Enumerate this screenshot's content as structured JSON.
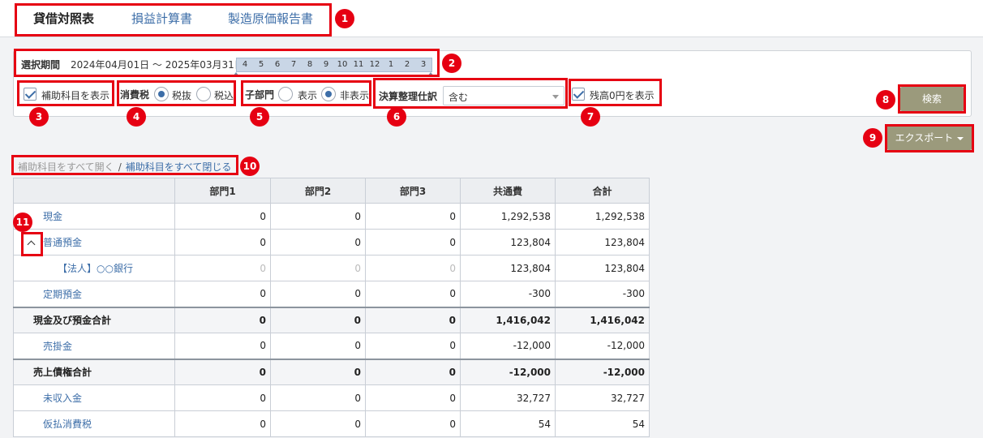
{
  "tabs": [
    {
      "label": "貸借対照表"
    },
    {
      "label": "損益計算書"
    },
    {
      "label": "製造原価報告書"
    }
  ],
  "period": {
    "label": "選択期間",
    "range": "2024年04月01日 ～ 2025年03月31日",
    "months": [
      "4",
      "5",
      "6",
      "7",
      "8",
      "9",
      "10",
      "11",
      "12",
      "1",
      "2",
      "3"
    ]
  },
  "filters": {
    "show_sub_accounts": "補助科目を表示",
    "tax_label": "消費税",
    "tax_excluded": "税抜",
    "tax_included": "税込",
    "subdept_label": "子部門",
    "subdept_show": "表示",
    "subdept_hide": "非表示",
    "closing_label": "決算整理仕訳",
    "closing_value": "含む",
    "show_zero": "残高0円を表示"
  },
  "buttons": {
    "search": "検索",
    "export": "エクスポート"
  },
  "links": {
    "expand_all": "補助科目をすべて開く",
    "separator": "/",
    "collapse_all": "補助科目をすべて閉じる"
  },
  "annotations": [
    "1",
    "2",
    "3",
    "4",
    "5",
    "6",
    "7",
    "8",
    "9",
    "10",
    "11"
  ],
  "table": {
    "headers": [
      "",
      "部門1",
      "部門2",
      "部門3",
      "共通費",
      "合計"
    ],
    "rows": [
      {
        "name": "現金",
        "cells": [
          "0",
          "0",
          "0",
          "1,292,538",
          "1,292,538"
        ]
      },
      {
        "name": "普通預金",
        "cells": [
          "0",
          "0",
          "0",
          "123,804",
          "123,804"
        ]
      },
      {
        "name": "【法人】○○銀行",
        "cells": [
          "0",
          "0",
          "0",
          "123,804",
          "123,804"
        ]
      },
      {
        "name": "定期預金",
        "cells": [
          "0",
          "0",
          "0",
          "-300",
          "-300"
        ]
      },
      {
        "name": "現金及び預金合計",
        "cells": [
          "0",
          "0",
          "0",
          "1,416,042",
          "1,416,042"
        ]
      },
      {
        "name": "売掛金",
        "cells": [
          "0",
          "0",
          "0",
          "-12,000",
          "-12,000"
        ]
      },
      {
        "name": "売上債権合計",
        "cells": [
          "0",
          "0",
          "0",
          "-12,000",
          "-12,000"
        ]
      },
      {
        "name": "未収入金",
        "cells": [
          "0",
          "0",
          "0",
          "32,727",
          "32,727"
        ]
      },
      {
        "name": "仮払消費税",
        "cells": [
          "0",
          "0",
          "0",
          "54",
          "54"
        ]
      }
    ]
  },
  "colors": {
    "accent": "#3d6ea8",
    "highlight": "#e60012",
    "button": "#9b9a7c"
  }
}
